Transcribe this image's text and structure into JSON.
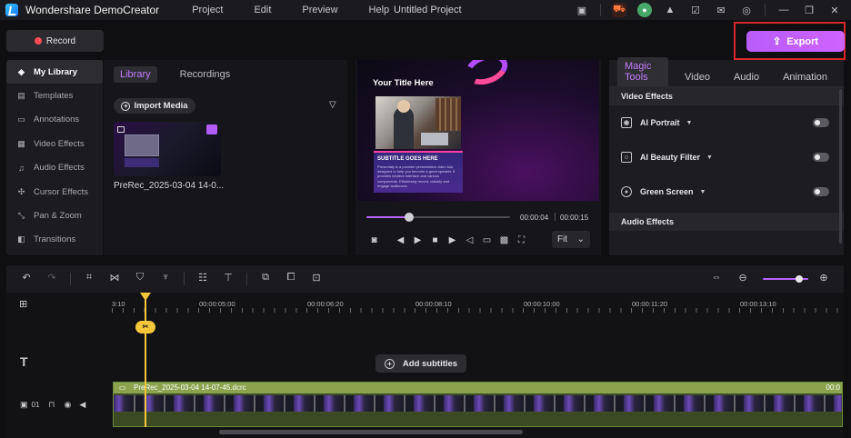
{
  "titlebar": {
    "app_name": "Wondershare DemoCreator",
    "menu": [
      "Project",
      "Edit",
      "Preview",
      "Help"
    ],
    "project_title": "Untitled Project"
  },
  "record": {
    "label": "Record"
  },
  "export": {
    "label": "Export"
  },
  "sidebar": {
    "items": [
      {
        "label": "My Library",
        "icon": "library-icon"
      },
      {
        "label": "Templates",
        "icon": "templates-icon"
      },
      {
        "label": "Annotations",
        "icon": "annotations-icon"
      },
      {
        "label": "Video Effects",
        "icon": "video-effects-icon"
      },
      {
        "label": "Audio Effects",
        "icon": "audio-effects-icon"
      },
      {
        "label": "Cursor Effects",
        "icon": "cursor-icon"
      },
      {
        "label": "Pan & Zoom",
        "icon": "pan-zoom-icon"
      },
      {
        "label": "Transitions",
        "icon": "transitions-icon"
      }
    ]
  },
  "library": {
    "tabs": [
      "Library",
      "Recordings"
    ],
    "import_label": "Import Media",
    "media": [
      {
        "name": "PreRec_2025-03-04 14-0..."
      }
    ]
  },
  "preview": {
    "title_text": "Your Title Here",
    "subtitle_text": "SUBTITLE GOES HERE",
    "body_text": "Presentaly is a provider presentation video tool, designed to help you become a great speaker. It provides intuitive interface and various components. Effortlessly record, classify and engage audiences.",
    "time_current": "00:00:04",
    "time_total": "00:00:15",
    "progress_fraction": 0.3,
    "fit_label": "Fit"
  },
  "right_panel": {
    "tabs": [
      "Magic Tools",
      "Video",
      "Audio",
      "Animation"
    ],
    "video_effects_header": "Video Effects",
    "rows": [
      {
        "label": "AI Portrait",
        "enabled": false
      },
      {
        "label": "AI Beauty Filter",
        "enabled": false
      },
      {
        "label": "Green Screen",
        "enabled": false
      }
    ],
    "audio_effects_header": "Audio Effects"
  },
  "timeline": {
    "ruler_labels": [
      "3:10",
      "00:00:05:00",
      "00:00:06:20",
      "00:00:08:10",
      "00:00:10:00",
      "00:00:11:20",
      "00:00:13:10"
    ],
    "add_subtitles_label": "Add subtitles",
    "track_number": "01",
    "clip_name": "PreRec_2025-03-04 14-07-45.dcrc",
    "clip_end_label": "00:0",
    "zoom_fraction": 0.8
  },
  "colors": {
    "accent": "#b764ff",
    "export": "#c85ff9",
    "record_dot": "#ff4b55",
    "playhead": "#f5c63a",
    "clip": "#8aa34c"
  }
}
